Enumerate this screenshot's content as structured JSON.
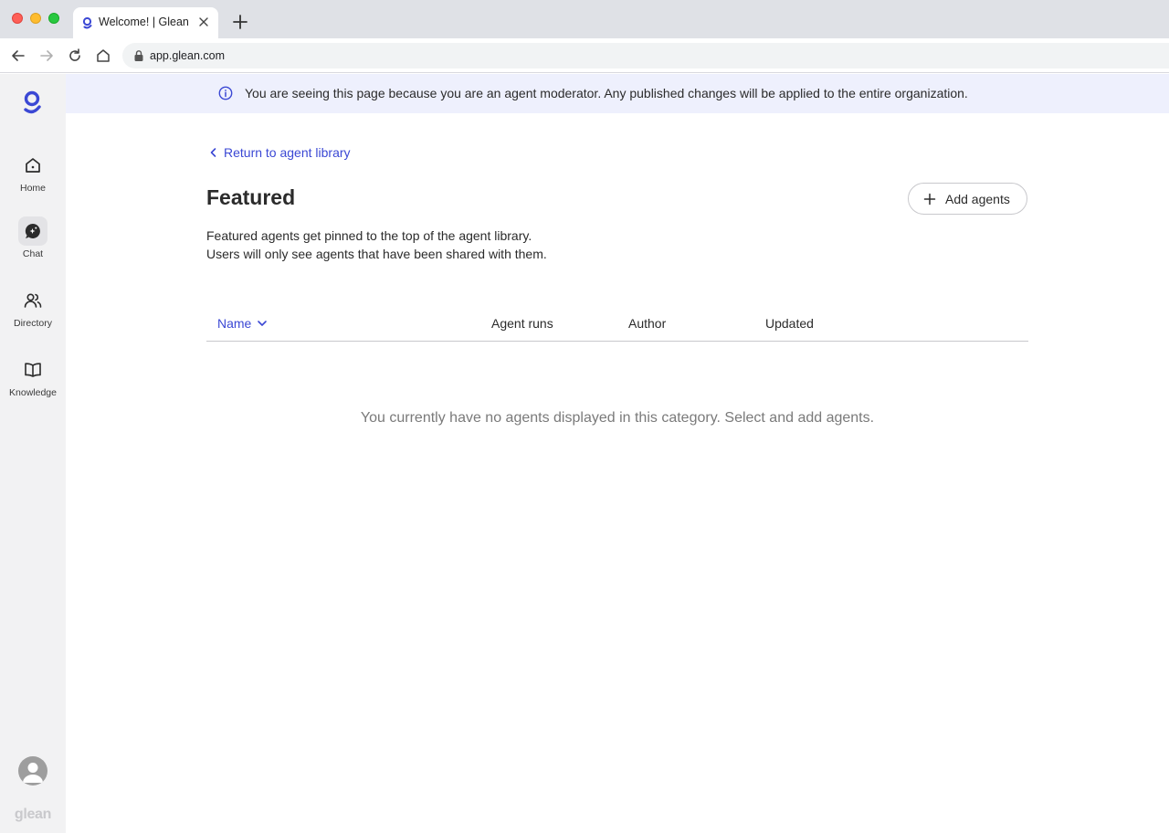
{
  "browser": {
    "tab_title": "Welcome! | Glean",
    "url": "app.glean.com"
  },
  "sidebar": {
    "wordmark": "glean",
    "items": [
      {
        "label": "Home",
        "icon": "home-icon"
      },
      {
        "label": "Chat",
        "icon": "chat-icon",
        "active": true
      },
      {
        "label": "Directory",
        "icon": "people-icon"
      },
      {
        "label": "Knowledge",
        "icon": "book-icon"
      }
    ]
  },
  "banner": {
    "text": "You are seeing this page because you are an agent moderator. Any published changes will be applied to the entire organization."
  },
  "main": {
    "return_link": "Return to agent library",
    "title": "Featured",
    "add_button": "Add agents",
    "description_line1": "Featured agents get pinned to the top of the agent library.",
    "description_line2": "Users will only see agents that have been shared with them.",
    "table": {
      "columns": [
        "Name",
        "Agent runs",
        "Author",
        "Updated"
      ]
    },
    "empty_message": "You currently have no agents displayed in this category. Select and add agents."
  },
  "colors": {
    "accent": "#3b48d4",
    "banner_bg": "#eef0fd",
    "sidebar_bg": "#f2f2f3"
  }
}
